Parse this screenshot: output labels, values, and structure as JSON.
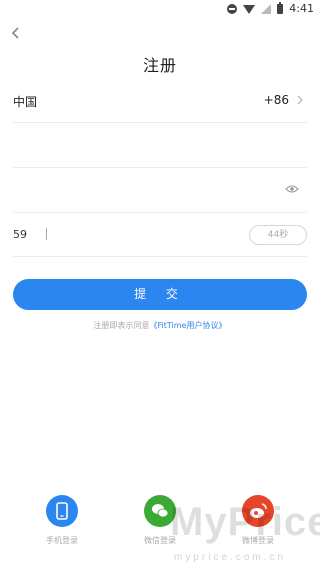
{
  "status_bar": {
    "time": "4:41",
    "icons": [
      "do-not-disturb-icon",
      "wifi-icon",
      "signal-icon",
      "battery-icon"
    ]
  },
  "header": {
    "back_icon": "chevron-left-icon",
    "title": "注册"
  },
  "form": {
    "country": {
      "name": "中国",
      "code": "+86",
      "icon": "chevron-right-icon"
    },
    "phone": {
      "value": ""
    },
    "password": {
      "value": "",
      "icon": "eye-icon"
    },
    "verification": {
      "value": "59",
      "countdown": "44秒"
    }
  },
  "submit": {
    "label": "提 交"
  },
  "agreement": {
    "prefix": "注册即表示同意",
    "link": "《FitTime用户协议》"
  },
  "login_options": [
    {
      "label": "手机登录",
      "icon": "phone-icon"
    },
    {
      "label": "微信登录",
      "icon": "wechat-icon"
    },
    {
      "label": "微博登录",
      "icon": "weibo-icon"
    }
  ],
  "watermark": {
    "text": "MyPrice",
    "subtext": "myprice.com.cn"
  },
  "colors": {
    "accent": "#2b86f0",
    "wechat": "#3aaa35",
    "weibo": "#e6452b"
  }
}
